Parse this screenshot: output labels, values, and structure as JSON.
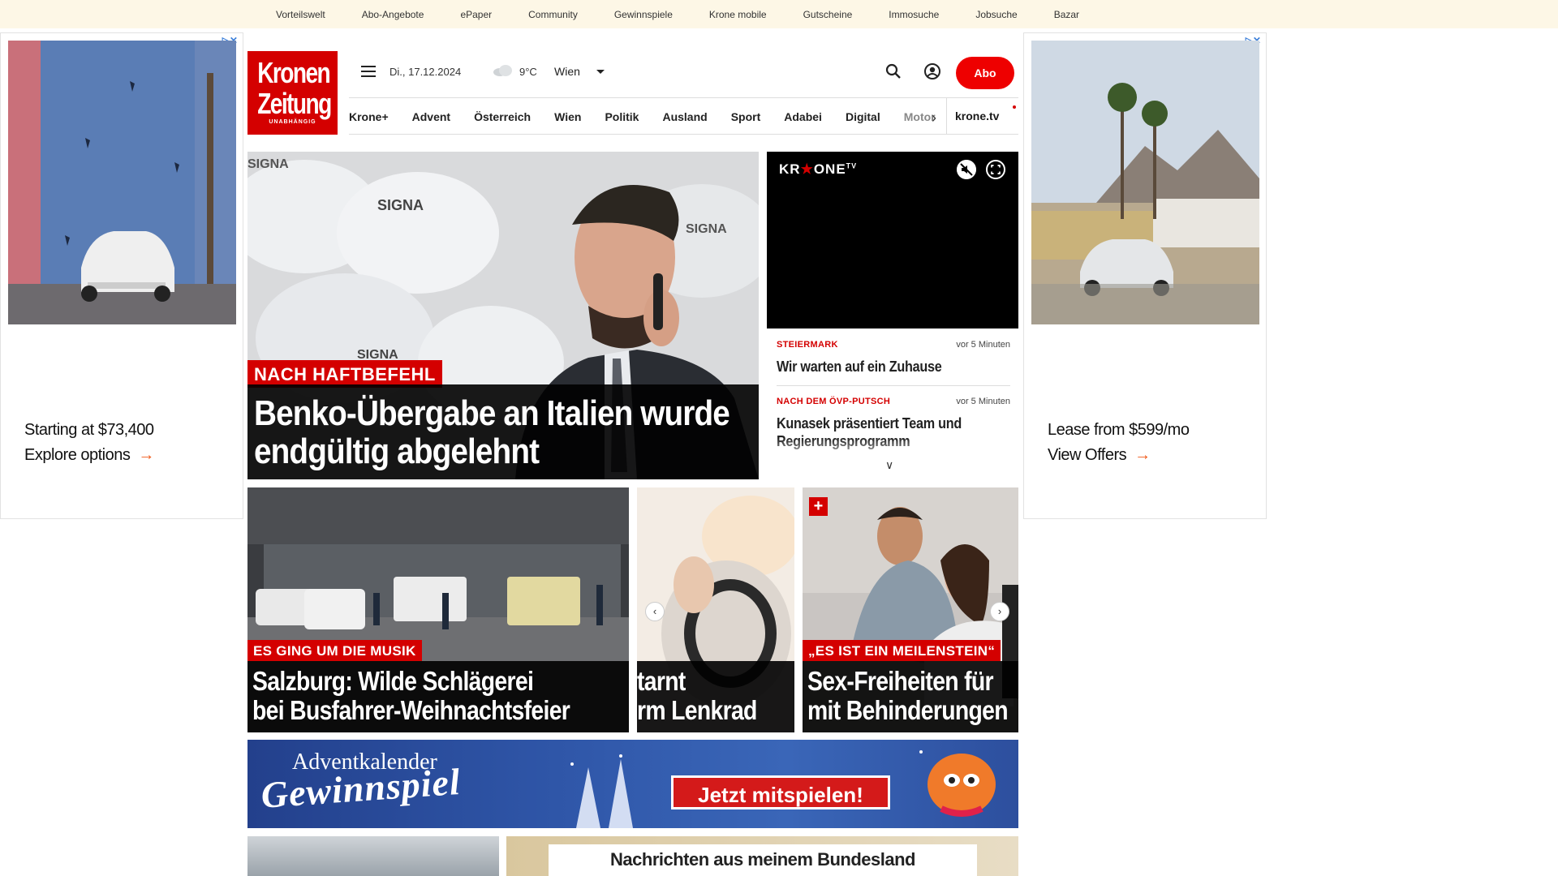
{
  "topbar": {
    "links": [
      "Vorteilswelt",
      "Abo-Angebote",
      "ePaper",
      "Community",
      "Gewinnspiele",
      "Krone mobile",
      "Gutscheine",
      "Immosuche",
      "Jobsuche",
      "Bazar"
    ]
  },
  "ads": {
    "left": {
      "price": "Starting at $73,400",
      "cta": "Explore options",
      "adchoice": "▷✕"
    },
    "right": {
      "price": "Lease from $599/mo",
      "cta": "View Offers",
      "adchoice": "▷✕"
    }
  },
  "logo": {
    "line1": "Kronen",
    "line2": "Zeitung",
    "line3": "UNABHÄNGIG"
  },
  "header": {
    "date": "Di., 17.12.2024",
    "weather_icon": "cloud-icon",
    "temperature": "9°C",
    "city": "Wien",
    "abo_label": "Abo"
  },
  "nav": {
    "items": [
      "Krone+",
      "Advent",
      "Österreich",
      "Wien",
      "Politik",
      "Ausland",
      "Sport",
      "Adabei",
      "Digital",
      "Motor"
    ],
    "extra": "krone.tv"
  },
  "hero": {
    "kicker": "NACH HAFTBEFEHL",
    "headline": "Benko-Übergabe an Italien wurde endgültig abgelehnt"
  },
  "video": {
    "brand_a": "KR",
    "brand_b": "ONE",
    "brand_tv": "TV"
  },
  "ticker": [
    {
      "category": "STEIERMARK",
      "time": "vor 5 Minuten",
      "title": "Wir warten auf ein Zuhause"
    },
    {
      "category": "NACH DEM ÖVP-PUTSCH",
      "time": "vor 5 Minuten",
      "title": "Kunasek präsentiert Team und Regierungsprogramm"
    }
  ],
  "cards": [
    {
      "kicker": "ES GING UM DIE MUSIK",
      "headline_l1": "Salzburg: Wilde Schlägerei",
      "headline_l2": "bei Busfahrer-Weihnachtsfeier"
    },
    {
      "kicker": "",
      "headline_l1": "tarnt",
      "headline_l2": "rm Lenkrad"
    },
    {
      "kicker": "„ES IST EIN MEILENSTEIN“",
      "headline_l1": "Sex-Freiheiten für",
      "headline_l2": "mit Behinderungen"
    }
  ],
  "advent": {
    "title": "Adventkalender",
    "subtitle": "Gewinnspiel",
    "button": "Jetzt mitspielen!"
  },
  "bundesland": {
    "label": "Nachrichten aus meinem Bundesland"
  }
}
